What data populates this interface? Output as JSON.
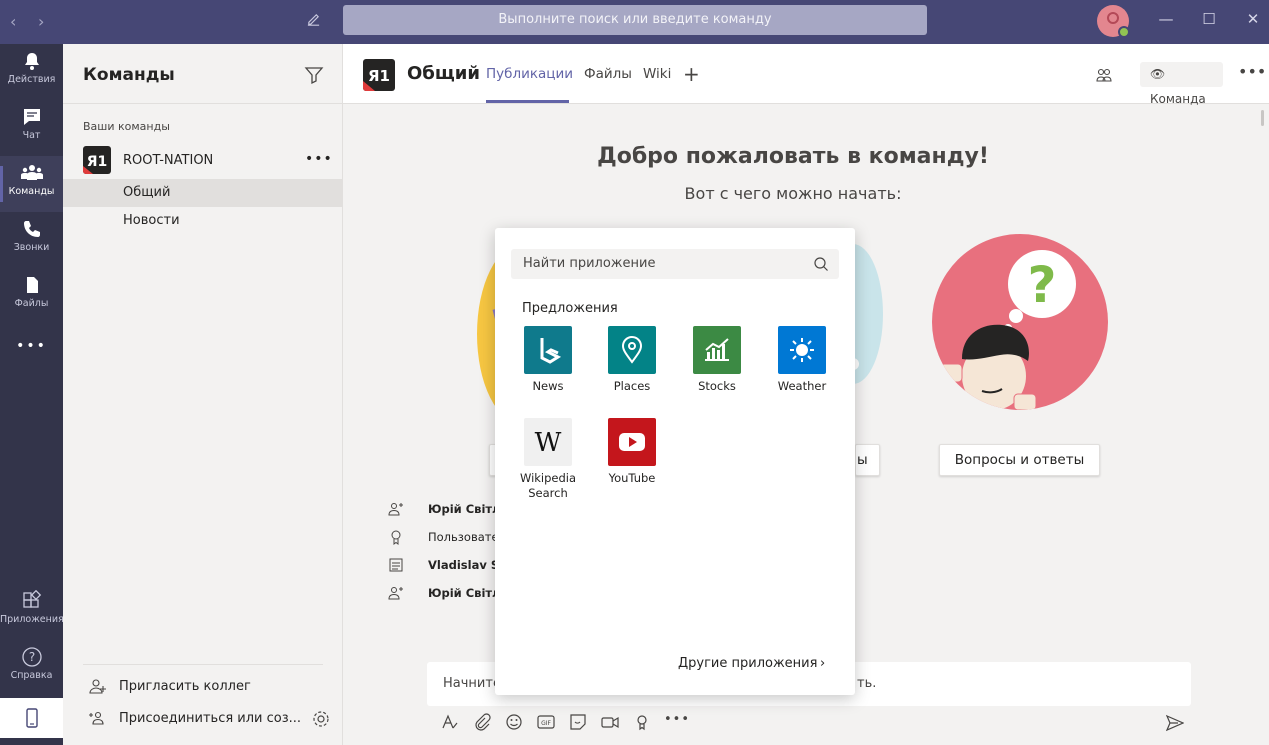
{
  "titlebar": {
    "back": "‹",
    "forward": "›",
    "search_placeholder": "Выполните поиск или введите команду",
    "minimize": "—",
    "maximize": "☐",
    "close": "✕"
  },
  "rail": {
    "items": [
      {
        "label": "Действия",
        "icon": "bell-icon"
      },
      {
        "label": "Чат",
        "icon": "chat-icon"
      },
      {
        "label": "Команды",
        "icon": "teams-icon",
        "active": true
      },
      {
        "label": "Звонки",
        "icon": "phone-icon"
      },
      {
        "label": "Файлы",
        "icon": "file-icon"
      },
      {
        "label": "•••",
        "icon": "more-icon"
      },
      {
        "label": "Приложения",
        "icon": "apps-icon"
      },
      {
        "label": "Справка",
        "icon": "help-icon"
      }
    ],
    "accent": "#6264a7"
  },
  "sidebar": {
    "title": "Команды",
    "your_teams": "Ваши команды",
    "team_name": "ROOT-NATION",
    "team_more": "•••",
    "channels": [
      "Общий",
      "Новости"
    ],
    "invite": "Пригласить коллег",
    "join": "Присоединиться или соз..."
  },
  "header": {
    "channel_title": "Общий",
    "tabs": [
      "Публикации",
      "Файлы",
      "Wiki"
    ],
    "add_tab": "+",
    "team_button": "Команда",
    "more": "•••"
  },
  "welcome": {
    "title": "Добро пожаловать в команду!",
    "subtitle": "Вот с чего можно начать:",
    "card_button_right": "Вопросы и ответы",
    "card_button_mid_partial": "ы"
  },
  "activity": [
    {
      "icon": "add-person-icon",
      "text": "Юрій Світлі"
    },
    {
      "icon": "badge-icon",
      "text": "Пользовате"
    },
    {
      "icon": "list-icon",
      "text": "Vladislav Sur"
    },
    {
      "icon": "add-person-icon",
      "text": "Юрій Світлі"
    }
  ],
  "compose": {
    "left_text": "Начните",
    "right_text": "ть."
  },
  "popup": {
    "search_placeholder": "Найти приложение",
    "section_title": "Предложения",
    "apps": [
      {
        "name": "News",
        "color": "#0f7a8c"
      },
      {
        "name": "Places",
        "color": "#038387"
      },
      {
        "name": "Stocks",
        "color": "#3c8a44"
      },
      {
        "name": "Weather",
        "color": "#0078d4"
      },
      {
        "name": "Wikipedia Search",
        "color": "#f0f0f0"
      },
      {
        "name": "YouTube",
        "color": "#c4161c"
      }
    ],
    "more_apps": "Другие приложения",
    "more_chevron": "›"
  }
}
